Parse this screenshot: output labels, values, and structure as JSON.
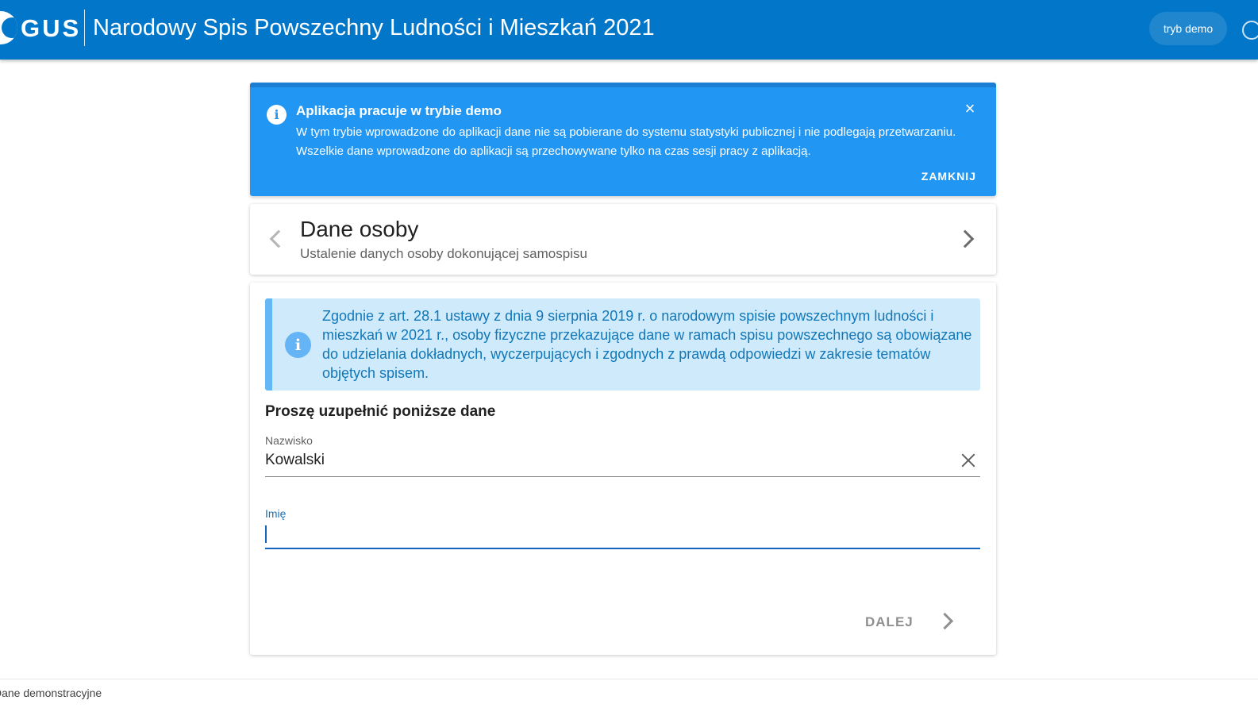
{
  "header": {
    "logo_text": "GUS",
    "title": "Narodowy Spis Powszechny Ludności i Mieszkań 2021",
    "demo_button": "tryb demo"
  },
  "banner": {
    "title": "Aplikacja pracuje w trybie demo",
    "text": "W tym trybie wprowadzone do aplikacji dane nie są pobierane do systemu statystyki publicznej i nie podlegają przetwarzaniu. Wszelkie dane wprowadzone do aplikacji są przechowywane tylko na czas sesji pracy z aplikacją.",
    "close_symbol": "×",
    "action": "ZAMKNIJ",
    "icon_symbol": "i"
  },
  "step": {
    "title": "Dane osoby",
    "subtitle": "Ustalenie danych osoby dokonującej samospisu"
  },
  "form": {
    "info_icon_symbol": "i",
    "info_text": "Zgodnie z art. 28.1 ustawy z dnia 9 sierpnia 2019 r. o narodowym spisie powszechnym ludności i mieszkań w 2021 r., osoby fizyczne przekazujące dane w ramach spisu powszechnego są obowiązane do udzielania dokładnych, wyczerpujących i zgodnych z prawdą odpowiedzi w zakresie tematów objętych spisem.",
    "section_label": "Proszę uzupełnić poniższe dane",
    "fields": [
      {
        "label": "Nazwisko",
        "value": "Kowalski"
      },
      {
        "label": "Imię",
        "value": ""
      }
    ],
    "next_button": "DALEJ"
  },
  "footer": {
    "text": "Dane demonstracyjne"
  },
  "colors": {
    "header_bg": "#0277c9",
    "banner_bg": "#2196f3",
    "info_bg": "#cfebfb",
    "info_text": "#1277b8",
    "focus_line": "#1565c0"
  }
}
